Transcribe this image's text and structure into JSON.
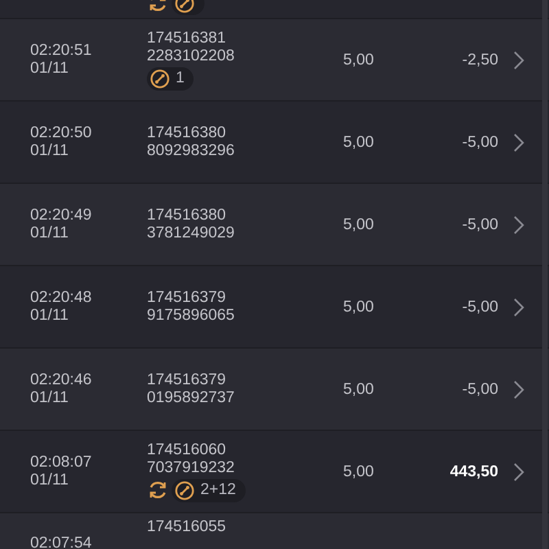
{
  "top_partial_row": {
    "badges": [
      {
        "kind": "spin"
      },
      {
        "kind": "bonus"
      }
    ]
  },
  "rows": [
    {
      "time": "02:20:51",
      "date": "01/11",
      "id_line_1": "174516381",
      "id_line_2": "2283102208",
      "stake": "5,00",
      "result": "-2,50",
      "highlight": false,
      "badges": [
        {
          "kind": "bonus",
          "count": "1"
        }
      ]
    },
    {
      "time": "02:20:50",
      "date": "01/11",
      "id_line_1": "174516380",
      "id_line_2": "8092983296",
      "stake": "5,00",
      "result": "-5,00",
      "highlight": false,
      "badges": []
    },
    {
      "time": "02:20:49",
      "date": "01/11",
      "id_line_1": "174516380",
      "id_line_2": "3781249029",
      "stake": "5,00",
      "result": "-5,00",
      "highlight": false,
      "badges": []
    },
    {
      "time": "02:20:48",
      "date": "01/11",
      "id_line_1": "174516379",
      "id_line_2": "9175896065",
      "stake": "5,00",
      "result": "-5,00",
      "highlight": false,
      "badges": []
    },
    {
      "time": "02:20:46",
      "date": "01/11",
      "id_line_1": "174516379",
      "id_line_2": "0195892737",
      "stake": "5,00",
      "result": "-5,00",
      "highlight": false,
      "badges": []
    },
    {
      "time": "02:08:07",
      "date": "01/11",
      "id_line_1": "174516060",
      "id_line_2": "7037919232",
      "stake": "5,00",
      "result": "443,50",
      "highlight": true,
      "badges": [
        {
          "kind": "spin"
        },
        {
          "kind": "bonus",
          "count": "2+12"
        }
      ]
    }
  ],
  "bottom_partial_row": {
    "time": "02:07:54",
    "id_line_1": "174516055"
  }
}
